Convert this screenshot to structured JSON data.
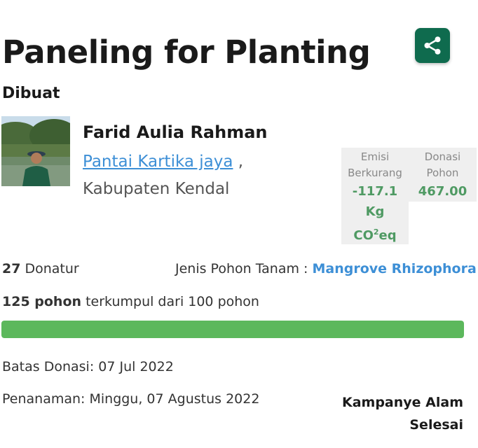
{
  "campaign": {
    "title": "Paneling for Planting",
    "created_label": "Dibuat"
  },
  "creator": {
    "name": "Farid Aulia Rahman",
    "location_link": "Pantai Kartika jaya",
    "location_sep": " ,",
    "regency": "Kabupaten Kendal"
  },
  "stats": {
    "emission_label": "Emisi Berkurang",
    "emission_value": "-117.1",
    "emission_unit": "Kg",
    "emission_unit_main": "CO",
    "emission_unit_sup": "2",
    "emission_unit_tail": "eq",
    "donation_label": "Donasi Pohon",
    "donation_value": "467.00"
  },
  "donors": {
    "count": "27",
    "label": " Donatur"
  },
  "tree_type": {
    "label": "Jenis Pohon Tanam : ",
    "value": "Mangrove Rhizophora"
  },
  "collection": {
    "collected": "125 pohon",
    "rest": " terkumpul dari 100 pohon",
    "progress_fraction": 1.0
  },
  "deadline": "Batas Donasi: 07 Jul 2022",
  "planting": "Penanaman: Minggu, 07 Agustus 2022",
  "status": "Kampanye Alam Selesai",
  "colors": {
    "accent_green": "#0f6b4e",
    "progress_green": "#5cb85c",
    "link_blue": "#3d8fd6",
    "stat_green": "#4f9a63"
  },
  "icons": {
    "share": "share-icon"
  }
}
